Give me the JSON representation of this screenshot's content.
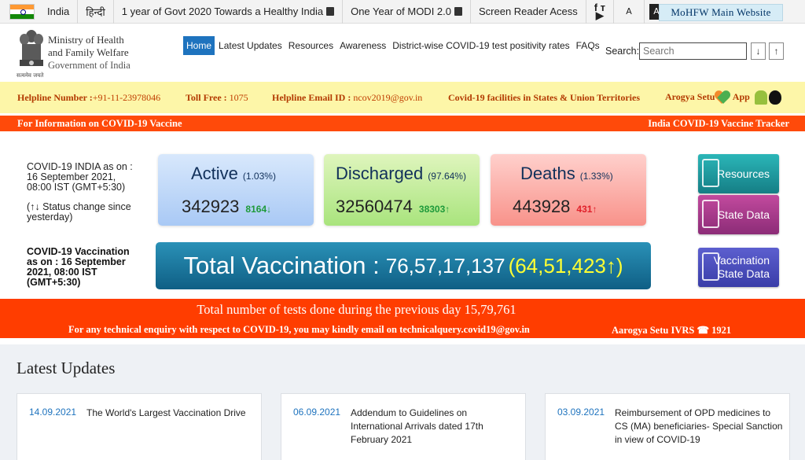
{
  "topbar": {
    "country": "India",
    "hindi": "हिन्दी",
    "link1": "1 year of Govt 2020 Towards a Healthy India",
    "link2": "One Year of MODI 2.0",
    "screen_reader": "Screen Reader Acess",
    "social_top": "f ᴛ",
    "social_bottom": "▶",
    "font_a": "A",
    "contrast_dark": "A",
    "contrast_light": "A",
    "main_site": "MoHFW Main Website"
  },
  "header": {
    "ministry_line1": "Ministry of Health",
    "ministry_line2": "and Family Welfare",
    "government": "Government of India",
    "motto": "सत्यमेव जयते",
    "nav": [
      "Home",
      "Latest Updates",
      "Resources",
      "Awareness",
      "District-wise COVID-19 test positivity rates",
      "FAQs"
    ],
    "search_label": "Search:",
    "search_placeholder": "Search",
    "down_arrow": "↓",
    "up_arrow": "↑"
  },
  "helpline": {
    "number_label": "Helpline Number :",
    "number": "+91-11-23978046",
    "tollfree_label": "Toll Free :",
    "tollfree": "1075",
    "email_label": "Helpline Email ID :",
    "email": "ncov2019@gov.in",
    "facilities": "Covid-19 facilities in States & Union Territories",
    "arogya": "Arogya Setu",
    "app": "App"
  },
  "vaccine_strip": {
    "left": "For Information on COVID-19 Vaccine",
    "right": "India COVID-19 Vaccine Tracker"
  },
  "stats": {
    "as_of": "COVID-19 INDIA as on : 16 September 2021, 08:00 IST (GMT+5:30)",
    "status_note": "(↑↓ Status change since yesterday)",
    "active": {
      "label": "Active",
      "pct": "(1.03%)",
      "value": "342923",
      "change": "8164↓"
    },
    "discharged": {
      "label": "Discharged",
      "pct": "(97.64%)",
      "value": "32560474",
      "change": "38303↑"
    },
    "deaths": {
      "label": "Deaths",
      "pct": "(1.33%)",
      "value": "443928",
      "change": "431↑"
    },
    "vacc_as_of": "COVID-19 Vaccination as on : 16 September 2021, 08:00 IST (GMT+5:30)",
    "total_vacc_label": "Total Vaccination :",
    "total_vacc_value": "76,57,17,137",
    "total_vacc_change": "(64,51,423↑)"
  },
  "side_buttons": {
    "resources": "Resources",
    "state_data": "State Data",
    "vacc_line1": "Vaccination",
    "vacc_line2": "State Data"
  },
  "notice": {
    "tests": "Total number of tests done during the previous day 15,79,761",
    "enquiry": "For any technical enquiry with respect to COVID-19, you may kindly email on technicalquery.covid19@gov.in",
    "ivrs": "Aarogya Setu IVRS ☎ 1921"
  },
  "updates": {
    "heading": "Latest Updates",
    "items": [
      {
        "date": "14.09.2021",
        "title": "The World's Largest Vaccination Drive"
      },
      {
        "date": "06.09.2021",
        "title": "Addendum to Guidelines on International Arrivals dated 17th February 2021"
      },
      {
        "date": "03.09.2021",
        "title": "Reimbursement of OPD medicines to CS (MA) beneficiaries- Special Sanction in view of COVID-19"
      }
    ]
  },
  "colors": {
    "orange_strip": "#ff4a0a",
    "help_bar": "#fdf6a8",
    "nav_active": "#1e73be"
  }
}
